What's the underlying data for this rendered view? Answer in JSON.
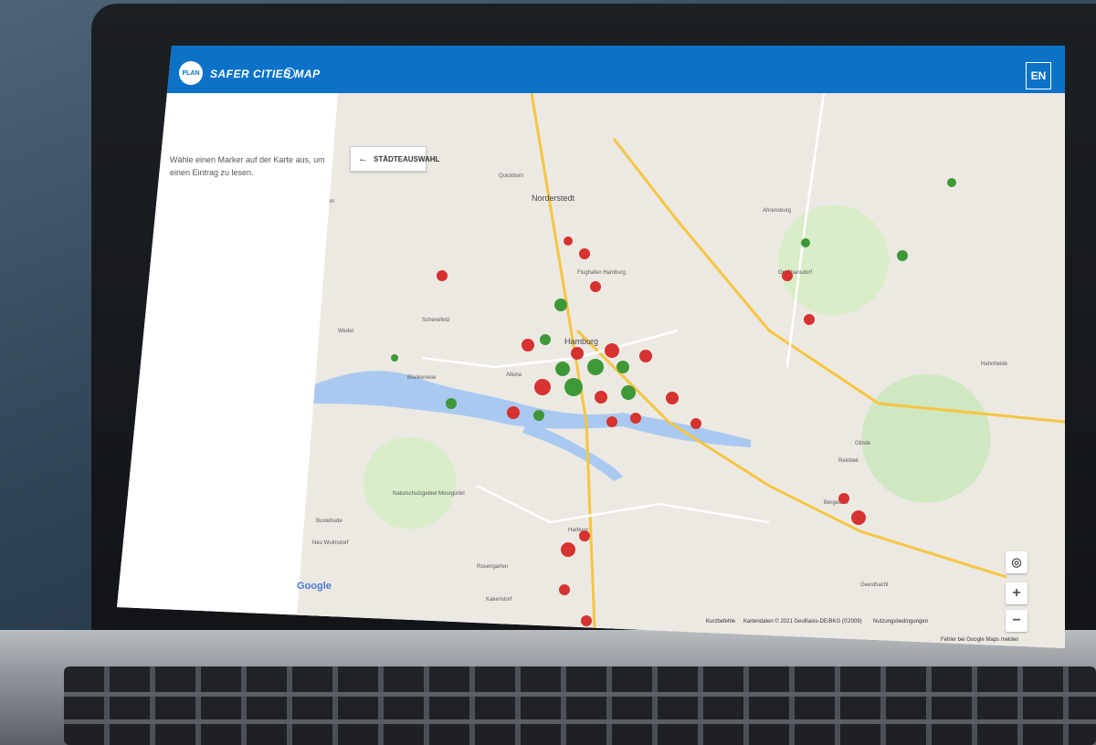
{
  "header": {
    "logo_text": "PLAN",
    "title": "SAFER CITIES MAP",
    "info": "i",
    "language_button": "EN"
  },
  "sidebar": {
    "hint": "Wähle einen Marker auf der Karte aus, um einen Eintrag zu lesen."
  },
  "map": {
    "city_button": "STÄDTEAUSWAHL",
    "google_logo": "Google",
    "footer": [
      "Kurzbefehle",
      "Kartendaten © 2021 GeoBasis-DE/BKG (©2009)",
      "Nutzungsbedingungen",
      "Fehler bei Google Maps melden"
    ],
    "places": [
      "Quickborn",
      "Norderstedt",
      "Ahrensburg",
      "Großhansdorf",
      "Uetersen",
      "Wedel",
      "Schenefeld",
      "Blankenese",
      "Altona",
      "Hamburg",
      "Hahnheide",
      "Reinbek",
      "Glinde",
      "Bergedorf",
      "Geesthacht",
      "Buxtehude",
      "Neu Wulmstorf",
      "Harburg",
      "Rosengarten",
      "Kakenstorf",
      "Naturschutzgebiet Moorgürtel",
      "Flughafen Hamburg"
    ],
    "marker_colors": {
      "red": "#d63230",
      "green": "#3f9838"
    }
  }
}
